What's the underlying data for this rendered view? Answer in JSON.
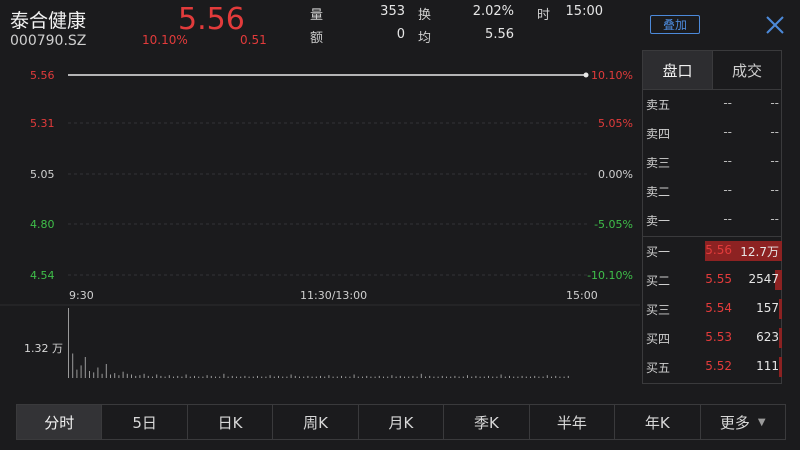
{
  "header": {
    "stock_name": "泰合健康",
    "stock_code": "000790.SZ",
    "price": "5.56",
    "change_pct": "10.10%",
    "change_amt": "0.51",
    "volume_label": "量",
    "volume_value": "353",
    "turnover_label": "换",
    "turnover_value": "2.02%",
    "time_label": "时",
    "time_value": "15:00",
    "amount_label": "额",
    "amount_value": "0",
    "avg_label": "均",
    "avg_value": "5.56",
    "overlay_label": "叠加"
  },
  "chart": {
    "price_ticks": [
      {
        "label": "5.56",
        "color": "#e23b3b"
      },
      {
        "label": "5.31",
        "color": "#e23b3b"
      },
      {
        "label": "5.05",
        "color": "#d0d0d0"
      },
      {
        "label": "4.80",
        "color": "#3fbf4a"
      },
      {
        "label": "4.54",
        "color": "#3fbf4a"
      }
    ],
    "pct_ticks": [
      {
        "label": "10.10%",
        "color": "#e23b3b"
      },
      {
        "label": "5.05%",
        "color": "#e23b3b"
      },
      {
        "label": "0.00%",
        "color": "#d0d0d0"
      },
      {
        "label": "-5.05%",
        "color": "#3fbf4a"
      },
      {
        "label": "-10.10%",
        "color": "#3fbf4a"
      }
    ],
    "time_ticks": [
      "9:30",
      "11:30/13:00",
      "15:00"
    ],
    "volume_label": "1.32 万",
    "price_line_value": 5.56,
    "price_range": [
      4.54,
      5.56
    ],
    "volume_bars": [
      1.0,
      0.35,
      0.12,
      0.18,
      0.3,
      0.1,
      0.08,
      0.15,
      0.06,
      0.2,
      0.05,
      0.07,
      0.04,
      0.09,
      0.06,
      0.05,
      0.03,
      0.04,
      0.06,
      0.03,
      0.02,
      0.05,
      0.03,
      0.02,
      0.04,
      0.02,
      0.03,
      0.02,
      0.05,
      0.02,
      0.03,
      0.02,
      0.02,
      0.04,
      0.03,
      0.02,
      0.02,
      0.06,
      0.02,
      0.03,
      0.02,
      0.02,
      0.03,
      0.02,
      0.02,
      0.03,
      0.02,
      0.02,
      0.04,
      0.02,
      0.03,
      0.02,
      0.02,
      0.05,
      0.03,
      0.02,
      0.02,
      0.03,
      0.02,
      0.02,
      0.03,
      0.02,
      0.04,
      0.02,
      0.02,
      0.03,
      0.02,
      0.02,
      0.05,
      0.02,
      0.02,
      0.03,
      0.02,
      0.02,
      0.03,
      0.02,
      0.02,
      0.04,
      0.02,
      0.03,
      0.02,
      0.02,
      0.03,
      0.02,
      0.06,
      0.02,
      0.03,
      0.02,
      0.02,
      0.03,
      0.02,
      0.02,
      0.03,
      0.02,
      0.02,
      0.04,
      0.02,
      0.03,
      0.02,
      0.02,
      0.03,
      0.02,
      0.02,
      0.05,
      0.02,
      0.03,
      0.02,
      0.02,
      0.03,
      0.02,
      0.02,
      0.03,
      0.02,
      0.02,
      0.04,
      0.02,
      0.03,
      0.02,
      0.02,
      0.03
    ]
  },
  "orderbook": {
    "tab_pankou": "盘口",
    "tab_trades": "成交",
    "sells": [
      {
        "label": "卖五",
        "price": "--",
        "vol": "--"
      },
      {
        "label": "卖四",
        "price": "--",
        "vol": "--"
      },
      {
        "label": "卖三",
        "price": "--",
        "vol": "--"
      },
      {
        "label": "卖二",
        "price": "--",
        "vol": "--"
      },
      {
        "label": "卖一",
        "price": "--",
        "vol": "--"
      }
    ],
    "buys": [
      {
        "label": "买一",
        "price": "5.56",
        "vol": "12.7万",
        "bar": 0.55
      },
      {
        "label": "买二",
        "price": "5.55",
        "vol": "2547",
        "bar": 0.05
      },
      {
        "label": "买三",
        "price": "5.54",
        "vol": "157",
        "bar": 0.01
      },
      {
        "label": "买四",
        "price": "5.53",
        "vol": "623",
        "bar": 0.02
      },
      {
        "label": "买五",
        "price": "5.52",
        "vol": "111",
        "bar": 0.01
      }
    ]
  },
  "tabs": [
    {
      "label": "分时"
    },
    {
      "label": "5日"
    },
    {
      "label": "日K"
    },
    {
      "label": "周K"
    },
    {
      "label": "月K"
    },
    {
      "label": "季K"
    },
    {
      "label": "半年"
    },
    {
      "label": "年K"
    },
    {
      "label": "更多"
    }
  ]
}
